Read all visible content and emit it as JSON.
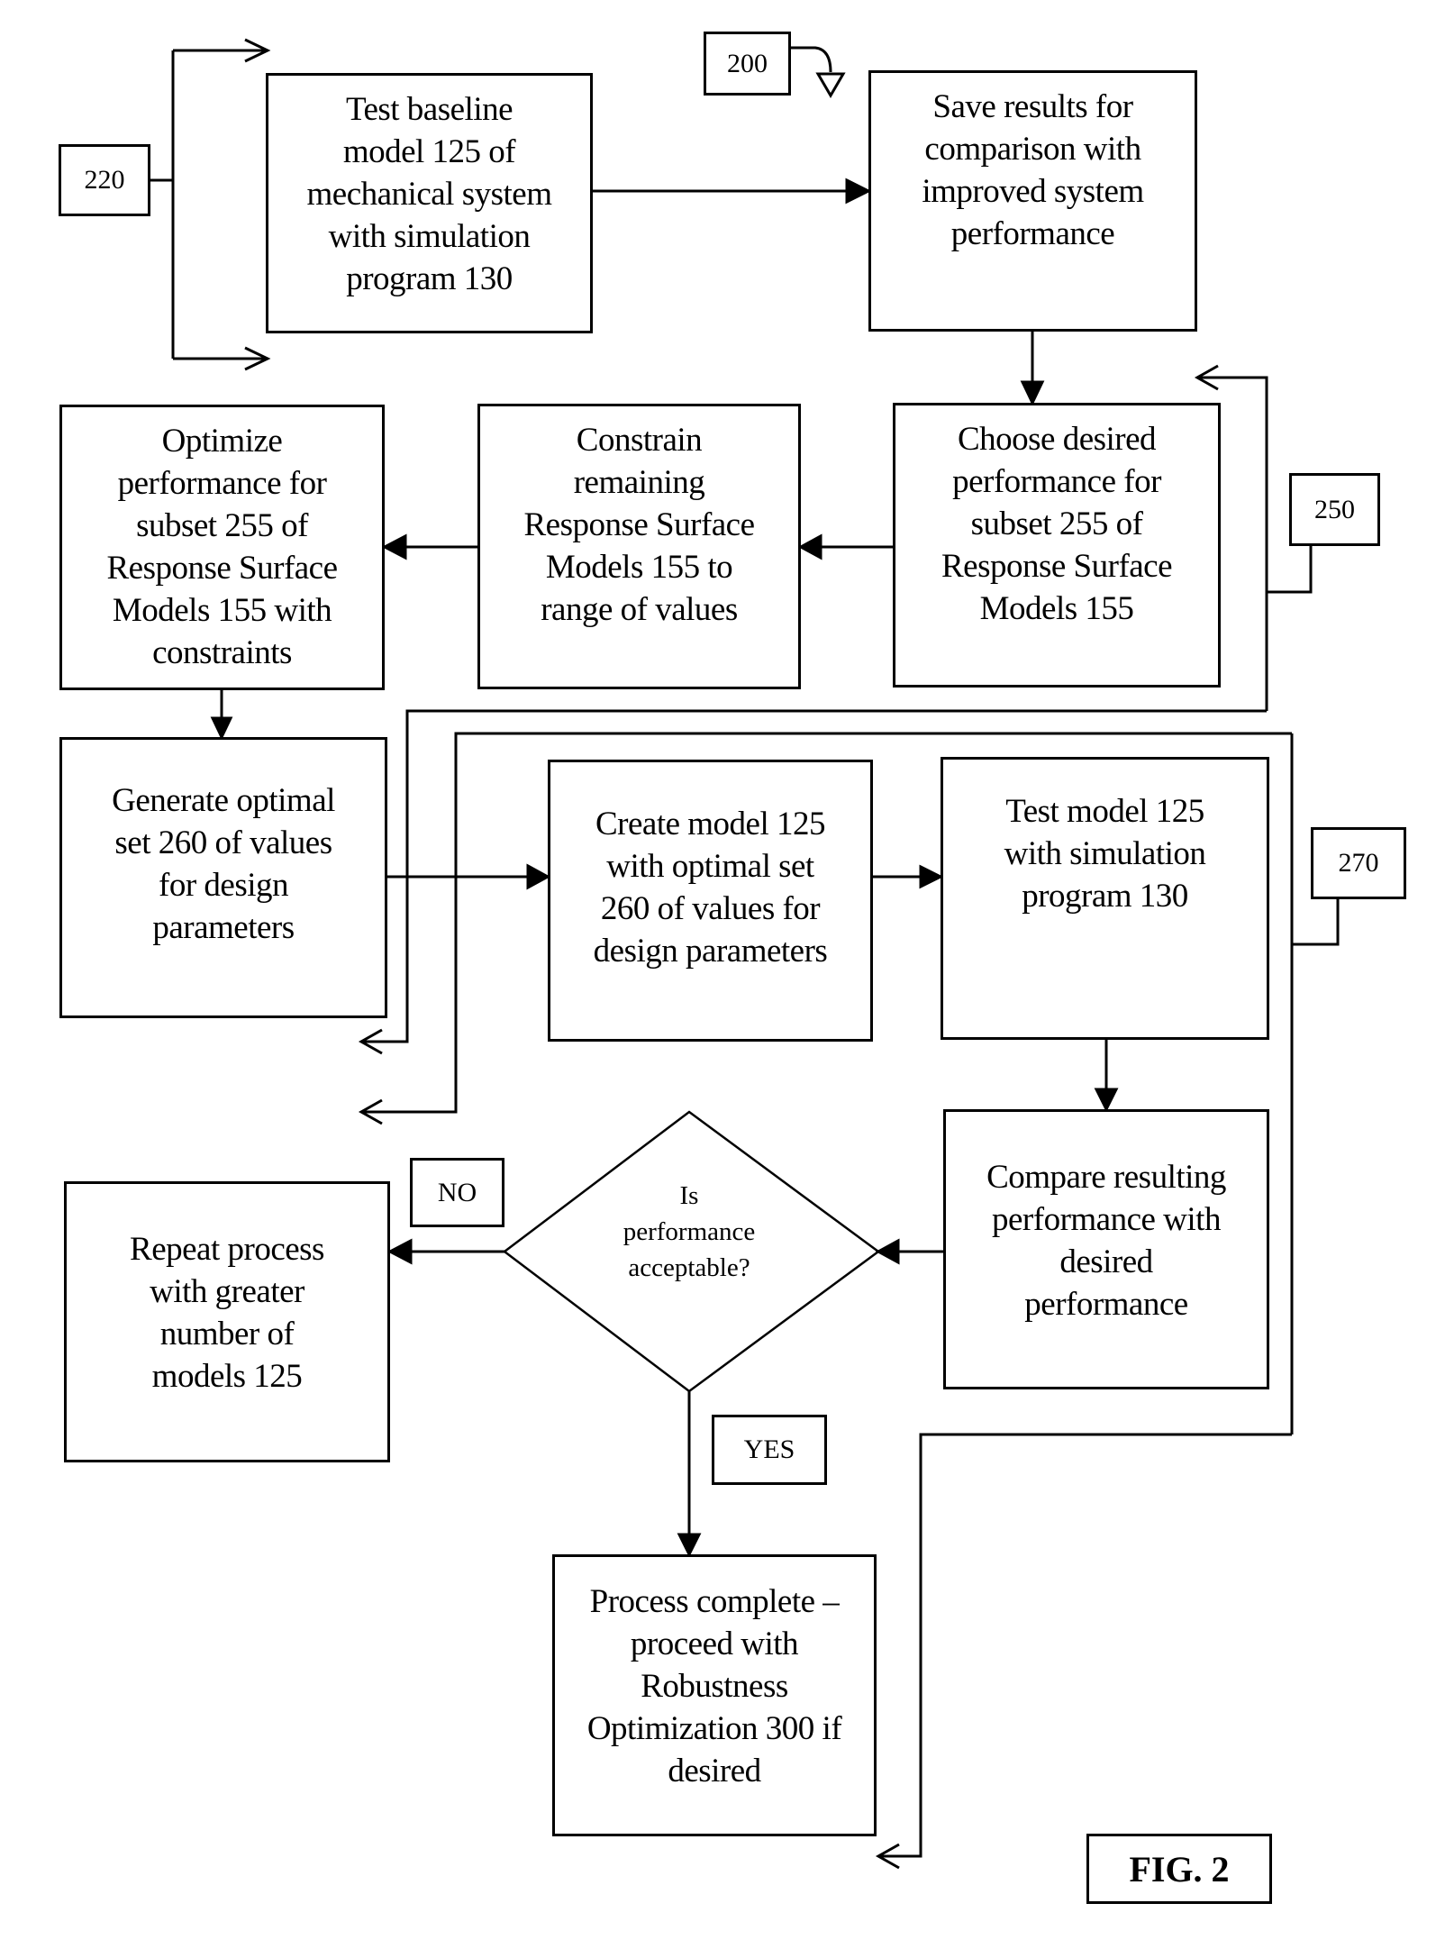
{
  "figure_label": "FIG. 2",
  "refs": {
    "r200": "200",
    "r220": "220",
    "r250": "250",
    "r270": "270"
  },
  "steps": {
    "test_baseline": "Test baseline\nmodel 125 of\nmechanical system\nwith simulation\nprogram 130",
    "save_results": "Save results for\ncomparison with\nimproved system\nperformance",
    "choose_desired": "Choose desired\nperformance for\nsubset 255 of\nResponse Surface\nModels 155",
    "constrain_remaining": "Constrain\nremaining\nResponse Surface\nModels 155 to\nrange of values",
    "optimize_performance": "Optimize\nperformance for\nsubset 255 of\nResponse Surface\nModels 155 with\nconstraints",
    "generate_optimal": "Generate optimal\nset 260 of values\nfor design\nparameters",
    "create_model": "Create model 125\nwith optimal set\n260 of values for\ndesign parameters",
    "test_model": "Test model 125\nwith simulation\nprogram 130",
    "compare_performance": "Compare resulting\nperformance with\ndesired\nperformance",
    "repeat_process": "Repeat process\nwith greater\nnumber of\nmodels 125",
    "process_complete": "Process complete –\nproceed with\nRobustness\nOptimization 300 if\ndesired"
  },
  "decision": {
    "question": "Is\nperformance\nacceptable?",
    "no_label": "NO",
    "yes_label": "YES"
  }
}
